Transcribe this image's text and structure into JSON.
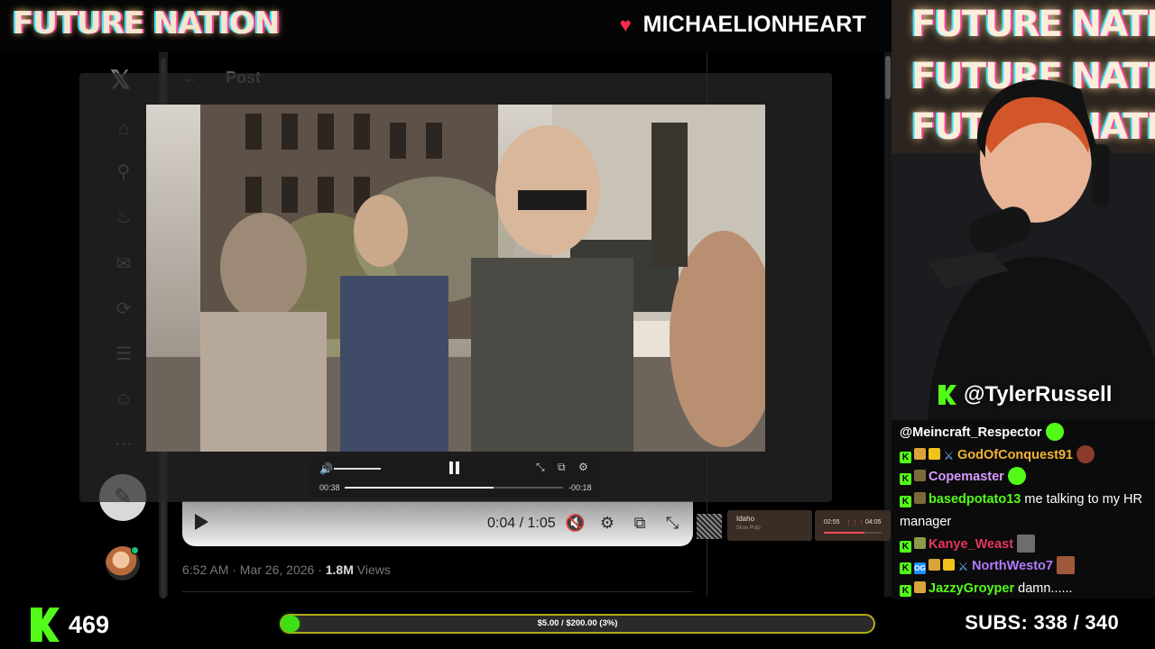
{
  "header": {
    "brand": "FUTURE NATION",
    "streamer": "MICHAELIONHEART"
  },
  "x_post": {
    "back_title": "Post",
    "inline_time": "0:04 / 1:05",
    "meta_time": "6:52 AM · Mar 26, 2026 · ",
    "views_value": "1.8M",
    "views_label": " Views"
  },
  "popup_player": {
    "elapsed": "00:38",
    "remaining": "-00:18",
    "progress": 0.68,
    "volume": 0.6
  },
  "music_widget": {
    "title": "Idaho",
    "artist": "Slow Pulp",
    "elapsed": "02:55",
    "total": "04:05",
    "progress": 0.71
  },
  "webcam": {
    "bg_line": "FUTURE NATION",
    "handle": "@TylerRussell"
  },
  "chat": {
    "messages": [
      {
        "user": "@Meincraft_Respector",
        "color": "#ffffff",
        "text": ""
      },
      {
        "user": "GodOfConquest91",
        "color": "#f2b233",
        "text": ""
      },
      {
        "user": "Copemaster",
        "color": "#d69aff",
        "text": ""
      },
      {
        "user": "basedpotato13",
        "color": "#53fc18",
        "text": "me talking to my HR manager"
      },
      {
        "user": "Kanye_Weast",
        "color": "#e2375a",
        "text": ""
      },
      {
        "user": "NorthWesto7",
        "color": "#b07cff",
        "text": ""
      },
      {
        "user": "JazzyGroyper",
        "color": "#53fc18",
        "text": "damn......"
      }
    ]
  },
  "footer": {
    "viewers": "469",
    "goal_text": "$5.00 / $200.00 (3%)",
    "goal_progress": 0.03,
    "subs": "SUBS:  338 / 340"
  },
  "colors": {
    "kick_green": "#53fc18",
    "heart": "#ff2b4f",
    "goal_border": "#b0ac18"
  }
}
